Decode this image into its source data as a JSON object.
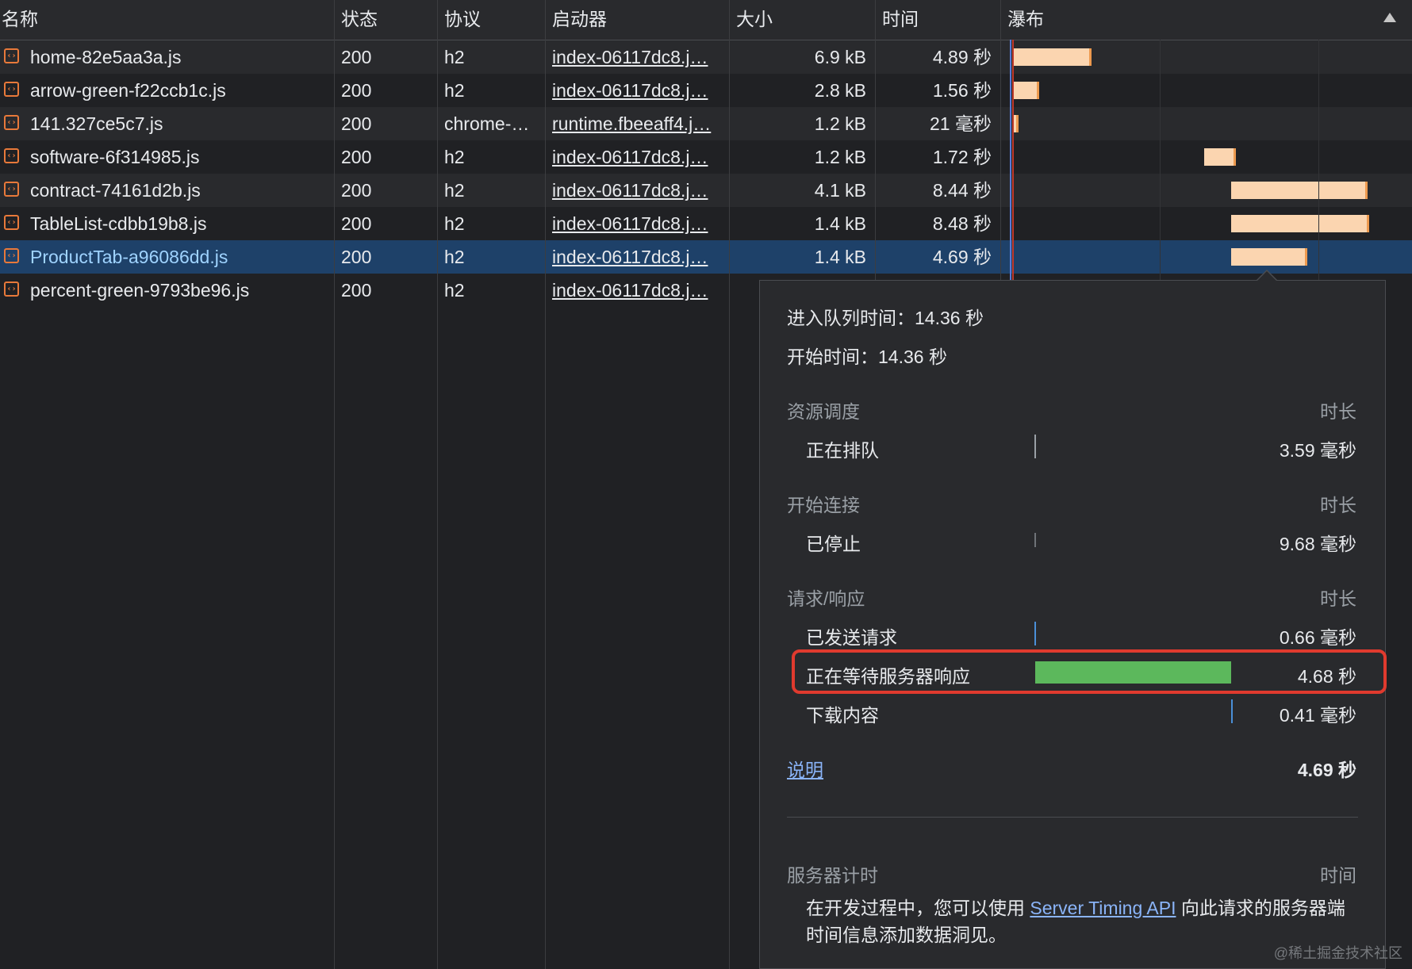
{
  "columns": {
    "name": "名称",
    "status": "状态",
    "protocol": "协议",
    "initiator": "启动器",
    "size": "大小",
    "time": "时间",
    "waterfall": "瀑布"
  },
  "requests": [
    {
      "name": "home-82e5aa3a.js",
      "status": "200",
      "protocol": "h2",
      "initiator": "index-06117dc8.j…",
      "size": "6.9 kB",
      "time": "4.89 秒"
    },
    {
      "name": "arrow-green-f22ccb1c.js",
      "status": "200",
      "protocol": "h2",
      "initiator": "index-06117dc8.j…",
      "size": "2.8 kB",
      "time": "1.56 秒"
    },
    {
      "name": "141.327ce5c7.js",
      "status": "200",
      "protocol": "chrome-…",
      "initiator": "runtime.fbeeaff4.j…",
      "size": "1.2 kB",
      "time": "21 毫秒"
    },
    {
      "name": "software-6f314985.js",
      "status": "200",
      "protocol": "h2",
      "initiator": "index-06117dc8.j…",
      "size": "1.2 kB",
      "time": "1.72 秒"
    },
    {
      "name": "contract-74161d2b.js",
      "status": "200",
      "protocol": "h2",
      "initiator": "index-06117dc8.j…",
      "size": "4.1 kB",
      "time": "8.44 秒"
    },
    {
      "name": "TableList-cdbb19b8.js",
      "status": "200",
      "protocol": "h2",
      "initiator": "index-06117dc8.j…",
      "size": "1.4 kB",
      "time": "8.48 秒"
    },
    {
      "name": "ProductTab-a96086dd.js",
      "status": "200",
      "protocol": "h2",
      "initiator": "index-06117dc8.j…",
      "size": "1.4 kB",
      "time": "4.69 秒"
    },
    {
      "name": "percent-green-9793be96.js",
      "status": "200",
      "protocol": "h2",
      "initiator": "index-06117dc8.j…",
      "size": "",
      "time": ""
    }
  ],
  "timing_popup": {
    "queued_at": "进入队列时间：14.36 秒",
    "started_at": "开始时间：14.36 秒",
    "sections": [
      {
        "title": "资源调度",
        "duration_header": "时长",
        "rows": [
          {
            "label": "正在排队",
            "value": "3.59 毫秒"
          }
        ]
      },
      {
        "title": "开始连接",
        "duration_header": "时长",
        "rows": [
          {
            "label": "已停止",
            "value": "9.68 毫秒"
          }
        ]
      },
      {
        "title": "请求/响应",
        "duration_header": "时长",
        "rows": [
          {
            "label": "已发送请求",
            "value": "0.66 毫秒"
          },
          {
            "label": "正在等待服务器响应",
            "value": "4.68 秒"
          },
          {
            "label": "下载内容",
            "value": "0.41 毫秒"
          }
        ]
      }
    ],
    "explanation_link": "说明",
    "total": "4.69 秒",
    "server_timing": {
      "title": "服务器计时",
      "time_header": "时间",
      "text_before": "在开发过程中，您可以使用 ",
      "link": "Server Timing API",
      "text_after": " 向此请求的服务器端时间信息添加数据洞见。"
    }
  },
  "watermark": "@稀土掘金技术社区",
  "colors": {
    "background": "#202124",
    "selected_row": "#1e4169",
    "bar_fill": "#fbd5b0",
    "bar_edge": "#ed9a4f",
    "waiting_bar": "#5cb85c",
    "highlight": "#e03a2e",
    "link": "#8ab4f8"
  },
  "icons": {
    "file": "script-file-icon",
    "sort": "sort-ascending-icon"
  }
}
